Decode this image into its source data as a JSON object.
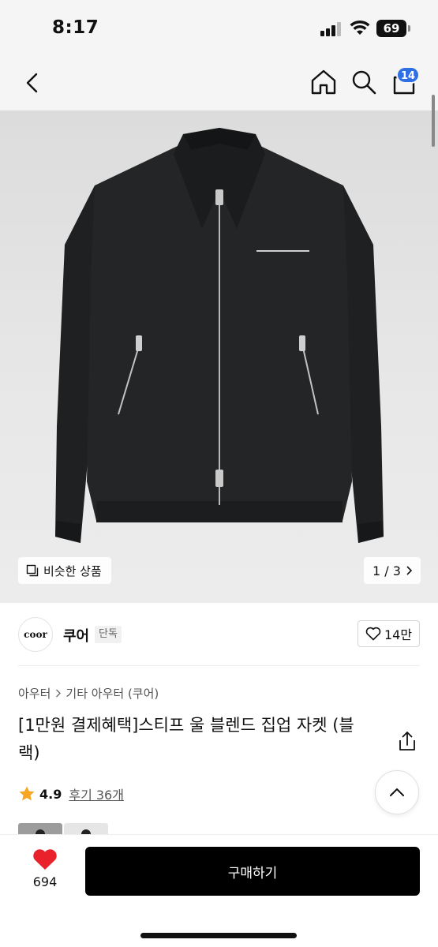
{
  "status_bar": {
    "time": "8:17",
    "battery": "69"
  },
  "nav": {
    "cart_count": "14"
  },
  "gallery": {
    "similar_label": "비슷한 상품",
    "page_indicator": "1 / 3"
  },
  "brand": {
    "logo_text": "coor",
    "name": "쿠어",
    "tag": "단독",
    "likes": "14만"
  },
  "breadcrumb": [
    "아우터",
    "기타 아우터 (쿠어)"
  ],
  "product": {
    "title": "[1만원 결제혜택]스티프 울 블렌드 집업 자켓 (블랙)",
    "rating": "4.9",
    "reviews_label": "후기 36개"
  },
  "bottom_bar": {
    "wish_count": "694",
    "buy_label": "구매하기"
  },
  "colors": {
    "accent_badge": "#2f6fe4",
    "wish_heart": "#e8212a",
    "star": "#f5a623",
    "buy_button": "#000000"
  },
  "icons": [
    "back-icon",
    "home-icon",
    "search-icon",
    "cart-icon",
    "similar-icon",
    "chevron-right-icon",
    "heart-outline-icon",
    "share-icon",
    "star-icon",
    "chevron-up-icon",
    "heart-filled-icon"
  ]
}
